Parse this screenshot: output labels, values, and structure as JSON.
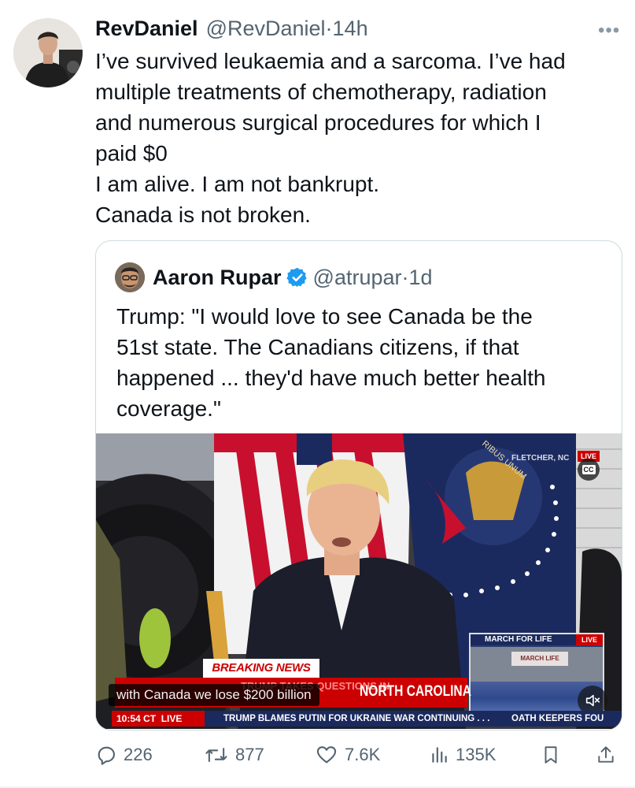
{
  "tweet": {
    "author_name": "RevDaniel",
    "author_handle": "@RevDaniel",
    "time": "14h",
    "more_label": "•••",
    "lines": [
      "I’ve survived leukaemia and a sarcoma.  I’ve had",
      "multiple treatments of chemotherapy, radiation",
      "and numerous surgical procedures for which I",
      "paid $0",
      "I am alive. I am not bankrupt.",
      "Canada is not broken."
    ]
  },
  "quoted": {
    "author_name": "Aaron Rupar",
    "author_handle": "@atrupar",
    "time": "1d",
    "verified_color": "#1d9bf0",
    "lines": [
      "Trump: \"I would love to see Canada be the",
      "51st state. The Canadians citizens, if that",
      "happened ... they'd have much better health",
      "coverage.\""
    ]
  },
  "video": {
    "location_tag": "FLETCHER, NC",
    "live_tag": "LIVE",
    "cc_label": "CC",
    "seal_text": "RIBUS UNUM",
    "breaking_label": "BREAKING NEWS",
    "headline_behind": "TRUMP TAKES QUESTIONS IN",
    "headline_main": "NORTH CAROLINA",
    "caption": "with Canada we lose $200 billion",
    "time_live": "10:54 CT  LIVE",
    "ticker": "TRUMP BLAMES PUTIN FOR UKRAINE WAR CONTINUING . . .",
    "ticker_right": "OATH KEEPERS FOU",
    "pip_label": "MARCH FOR LIFE",
    "pip_live": "LIVE",
    "pip_sign": "MARCH    LIFE",
    "mute_icon": "speaker-mute-icon",
    "colors": {
      "red": "#c8102e",
      "navy": "#1b2a5e",
      "cnn_red": "#cc0000"
    }
  },
  "actions": {
    "replies": "226",
    "reposts": "877",
    "likes": "7.6K",
    "views": "135K"
  },
  "colors": {
    "text": "#0f1419",
    "muted": "#536471",
    "border": "#cfd9de"
  }
}
